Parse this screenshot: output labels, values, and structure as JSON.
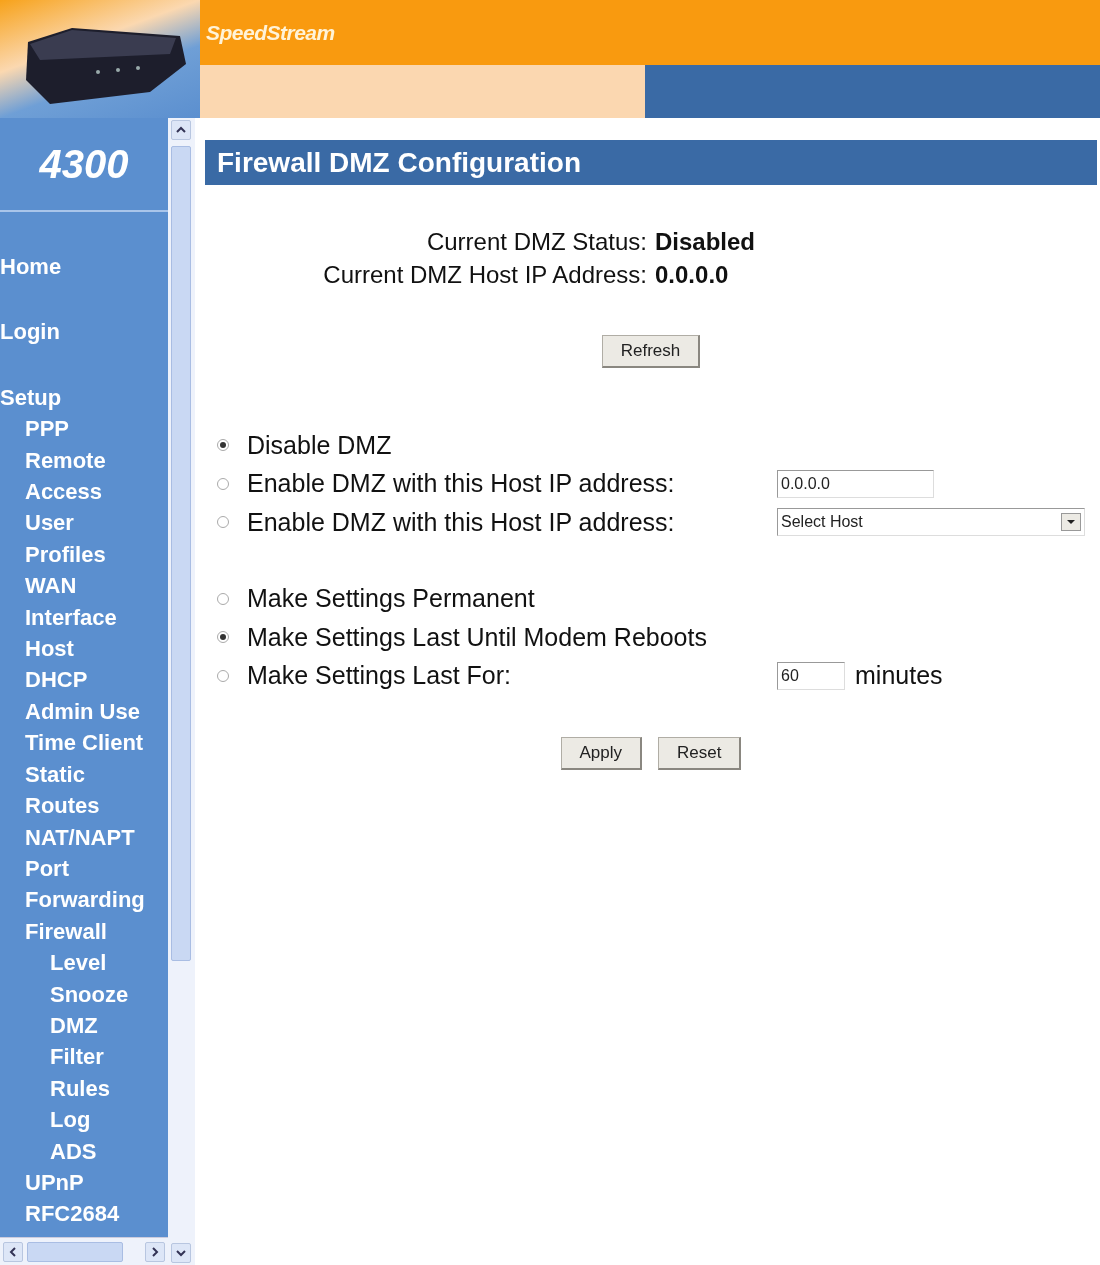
{
  "header": {
    "brand": "SpeedStream",
    "model": "4300"
  },
  "sidebar": {
    "items": [
      {
        "label": "Home"
      },
      {
        "label": "Login"
      },
      {
        "label": "Setup",
        "children": [
          {
            "label": "PPP"
          },
          {
            "label": "Remote\nAccess"
          },
          {
            "label": "User\nProfiles"
          },
          {
            "label": "WAN\nInterface"
          },
          {
            "label": "Host"
          },
          {
            "label": "DHCP"
          },
          {
            "label": "Admin Use"
          },
          {
            "label": "Time Client"
          },
          {
            "label": "Static\nRoutes"
          },
          {
            "label": "NAT/NAPT"
          },
          {
            "label": "Port\nForwarding"
          },
          {
            "label": "Firewall",
            "children": [
              {
                "label": "Level"
              },
              {
                "label": "Snooze"
              },
              {
                "label": "DMZ"
              },
              {
                "label": "Filter\nRules"
              },
              {
                "label": "Log"
              },
              {
                "label": "ADS"
              }
            ]
          },
          {
            "label": "UPnP"
          },
          {
            "label": "RFC2684"
          }
        ]
      }
    ]
  },
  "page": {
    "title": "Firewall DMZ Configuration",
    "status": [
      {
        "label": "Current DMZ Status:",
        "value": "Disabled"
      },
      {
        "label": "Current DMZ Host IP Address:",
        "value": "0.0.0.0"
      }
    ],
    "refresh_button": "Refresh",
    "dmz_options": [
      {
        "label": "Disable DMZ",
        "selected": true,
        "kind": "plain"
      },
      {
        "label": "Enable DMZ with this Host IP address:",
        "selected": false,
        "kind": "text",
        "value": "0.0.0.0"
      },
      {
        "label": "Enable DMZ with this Host IP address:",
        "selected": false,
        "kind": "select",
        "value": "Select Host"
      }
    ],
    "duration_options": [
      {
        "label": "Make Settings Permanent",
        "selected": false,
        "kind": "plain"
      },
      {
        "label": "Make Settings Last Until Modem Reboots",
        "selected": true,
        "kind": "plain"
      },
      {
        "label": "Make Settings Last For:",
        "selected": false,
        "kind": "text",
        "value": "60",
        "unit": "minutes"
      }
    ],
    "buttons": [
      "Apply",
      "Reset"
    ]
  }
}
